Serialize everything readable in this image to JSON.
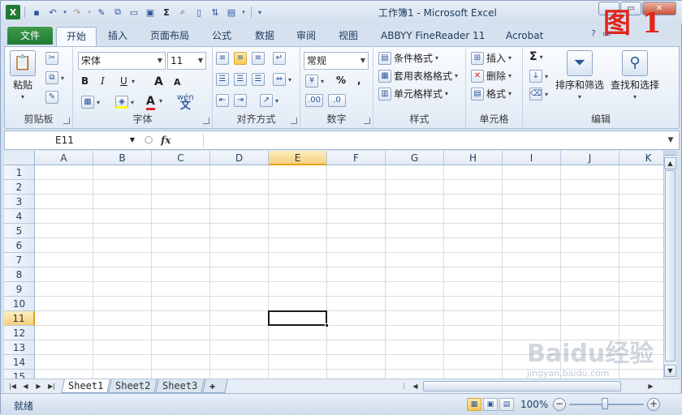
{
  "window": {
    "title": "工作簿1 - Microsoft Excel",
    "figure_label": "图 1"
  },
  "qat": {
    "items": [
      "excel-logo",
      "save",
      "undo",
      "redo",
      "format-painter",
      "copy",
      "open",
      "insert-picture",
      "sum",
      "print-preview",
      "new",
      "sort",
      "paste-special",
      "more"
    ]
  },
  "tabs": {
    "file": "文件",
    "items": [
      "开始",
      "插入",
      "页面布局",
      "公式",
      "数据",
      "审阅",
      "视图",
      "ABBYY FineReader 11",
      "Acrobat"
    ]
  },
  "ribbon": {
    "clipboard": {
      "label": "剪贴板",
      "paste": "粘贴"
    },
    "font": {
      "label": "字体",
      "font_name": "宋体",
      "font_size": "11",
      "bold": "B",
      "italic": "I",
      "underline": "U",
      "grow": "A",
      "shrink": "A",
      "font_color": "A",
      "phonetic": "wén"
    },
    "alignment": {
      "label": "对齐方式"
    },
    "number": {
      "label": "数字",
      "format": "常规",
      "percent": "%",
      "comma": ","
    },
    "styles": {
      "label": "样式",
      "conditional": "条件格式",
      "table": "套用表格格式",
      "cell_styles": "单元格样式"
    },
    "cells": {
      "label": "单元格",
      "insert": "插入",
      "delete": "删除",
      "format": "格式"
    },
    "editing": {
      "label": "编辑",
      "sort_filter": "排序和筛选",
      "find_select": "查找和选择",
      "sum": "Σ"
    }
  },
  "formula_bar": {
    "name_box": "E11",
    "fx": "fx",
    "content": ""
  },
  "grid": {
    "columns": [
      "A",
      "B",
      "C",
      "D",
      "E",
      "F",
      "G",
      "H",
      "I",
      "J",
      "K"
    ],
    "rows": [
      "1",
      "2",
      "3",
      "4",
      "5",
      "6",
      "7",
      "8",
      "9",
      "10",
      "11",
      "12",
      "13",
      "14",
      "15"
    ],
    "selected_column": "E",
    "selected_row": "11"
  },
  "sheets": {
    "tabs": [
      "Sheet1",
      "Sheet2",
      "Sheet3"
    ],
    "active": "Sheet1"
  },
  "status": {
    "text": "就绪",
    "zoom": "100%"
  },
  "watermark": {
    "text": "Baidu经验",
    "sub": "jingyan.baidu.com"
  },
  "colors": {
    "file_tab": "#2e8b3e",
    "selected_header": "#f4d07d",
    "figure_label": "#e2261b"
  }
}
